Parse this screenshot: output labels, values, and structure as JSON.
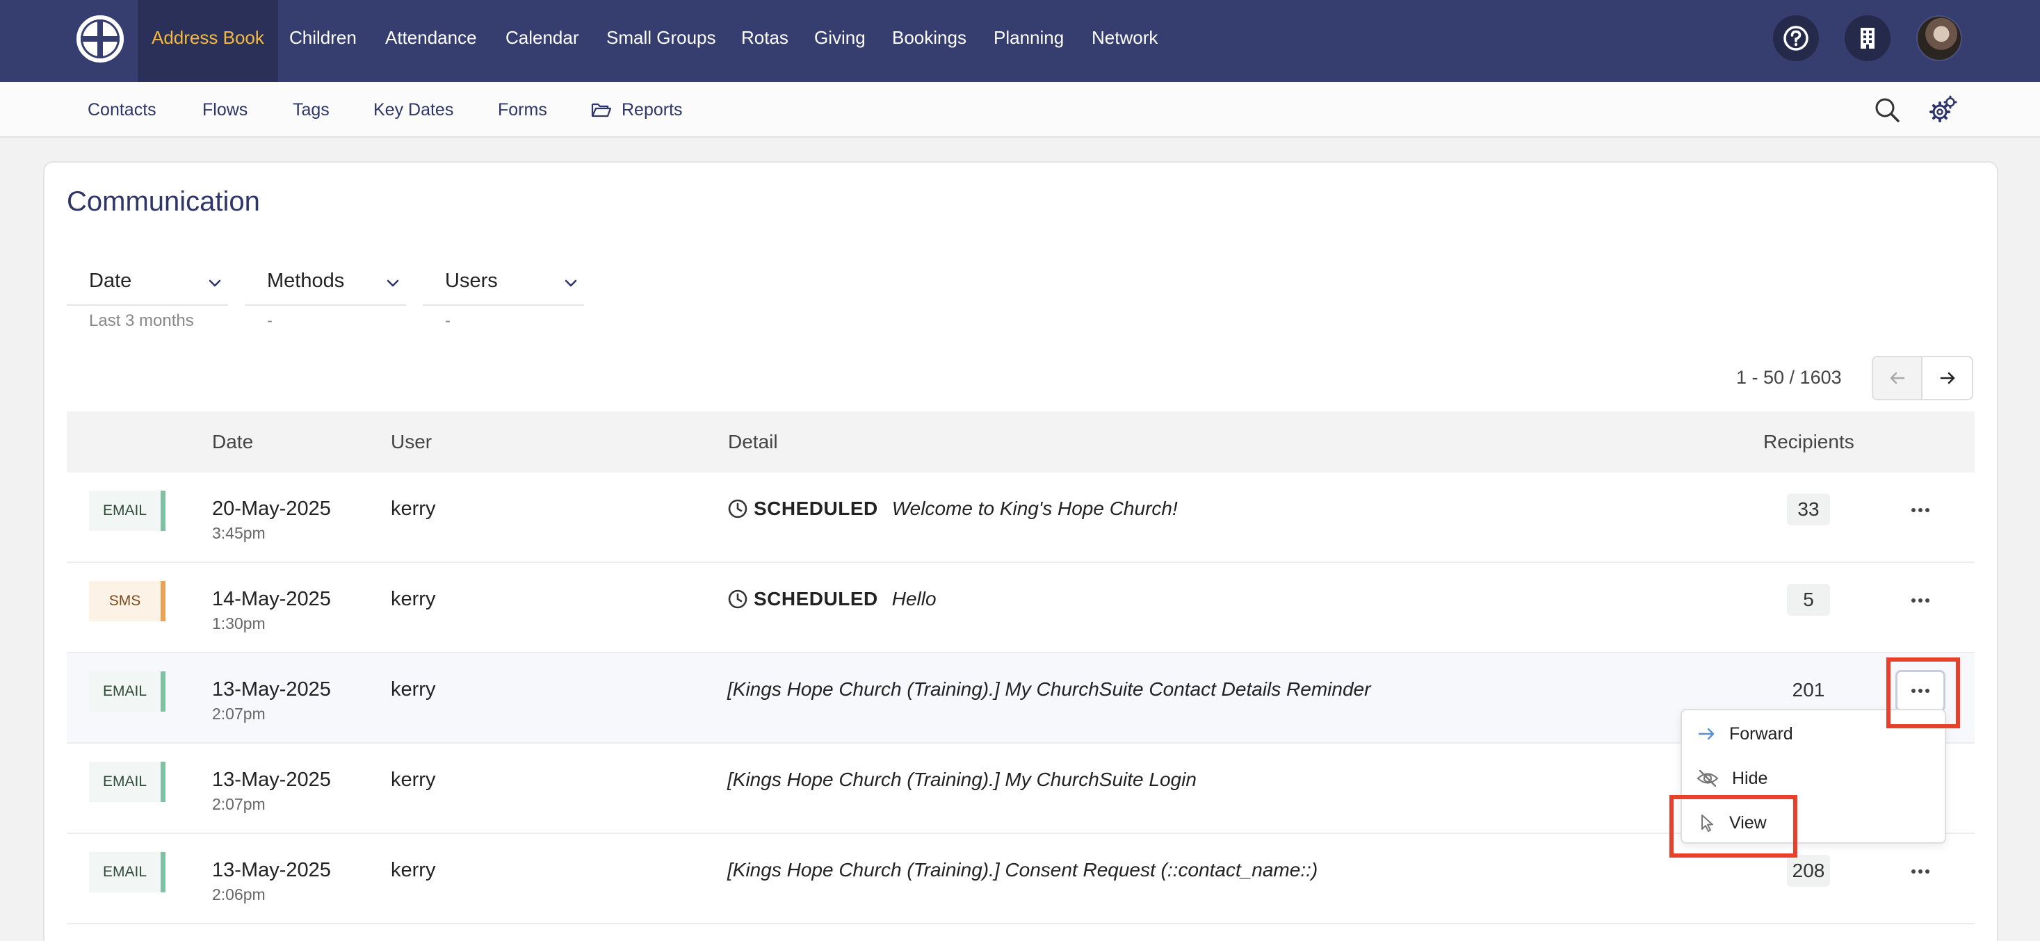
{
  "topnav": {
    "items": [
      {
        "label": "Address Book",
        "active": true
      },
      {
        "label": "Children"
      },
      {
        "label": "Attendance"
      },
      {
        "label": "Calendar"
      },
      {
        "label": "Small Groups"
      },
      {
        "label": "Rotas"
      },
      {
        "label": "Giving"
      },
      {
        "label": "Bookings"
      },
      {
        "label": "Planning"
      },
      {
        "label": "Network"
      }
    ],
    "icons": [
      "help-icon",
      "building-icon",
      "user-avatar"
    ],
    "colors": {
      "bar": "#363d6f",
      "active_text": "#f4b942"
    }
  },
  "subnav": {
    "items": [
      {
        "label": "Contacts"
      },
      {
        "label": "Flows"
      },
      {
        "label": "Tags"
      },
      {
        "label": "Key Dates"
      },
      {
        "label": "Forms"
      },
      {
        "label": "Reports",
        "icon": "folder-open-icon"
      }
    ],
    "icons": [
      "search-icon",
      "settings-gears-icon"
    ]
  },
  "page": {
    "title": "Communication"
  },
  "filters": [
    {
      "label": "Date",
      "value": "Last 3 months"
    },
    {
      "label": "Methods",
      "value": "-"
    },
    {
      "label": "Users",
      "value": "-"
    }
  ],
  "pagination": {
    "text": "1 - 50 / 1603"
  },
  "table": {
    "headers": {
      "date": "Date",
      "user": "User",
      "detail": "Detail",
      "recipients": "Recipients"
    },
    "rows": [
      {
        "method": "EMAIL",
        "date": "20-May-2025",
        "time": "3:45pm",
        "user": "kerry",
        "status": "SCHEDULED",
        "subject": "Welcome to King's Hope Church!",
        "recipients": "33"
      },
      {
        "method": "SMS",
        "date": "14-May-2025",
        "time": "1:30pm",
        "user": "kerry",
        "status": "SCHEDULED",
        "subject": "Hello",
        "recipients": "5"
      },
      {
        "method": "EMAIL",
        "date": "13-May-2025",
        "time": "2:07pm",
        "user": "kerry",
        "status": "",
        "subject": "[Kings Hope Church (Training).] My ChurchSuite Contact Details Reminder",
        "recipients": "201"
      },
      {
        "method": "EMAIL",
        "date": "13-May-2025",
        "time": "2:07pm",
        "user": "kerry",
        "status": "",
        "subject": "[Kings Hope Church (Training).] My ChurchSuite Login",
        "recipients": ""
      },
      {
        "method": "EMAIL",
        "date": "13-May-2025",
        "time": "2:06pm",
        "user": "kerry",
        "status": "",
        "subject": "[Kings Hope Church (Training).] Consent Request (::contact_name::)",
        "recipients": "208"
      }
    ]
  },
  "row_menu": {
    "items": [
      {
        "label": "Forward",
        "icon": "arrow-right-icon"
      },
      {
        "label": "Hide",
        "icon": "eye-slash-icon"
      },
      {
        "label": "View",
        "icon": "pointer-icon"
      }
    ]
  },
  "annotation_color": "#e8402b"
}
